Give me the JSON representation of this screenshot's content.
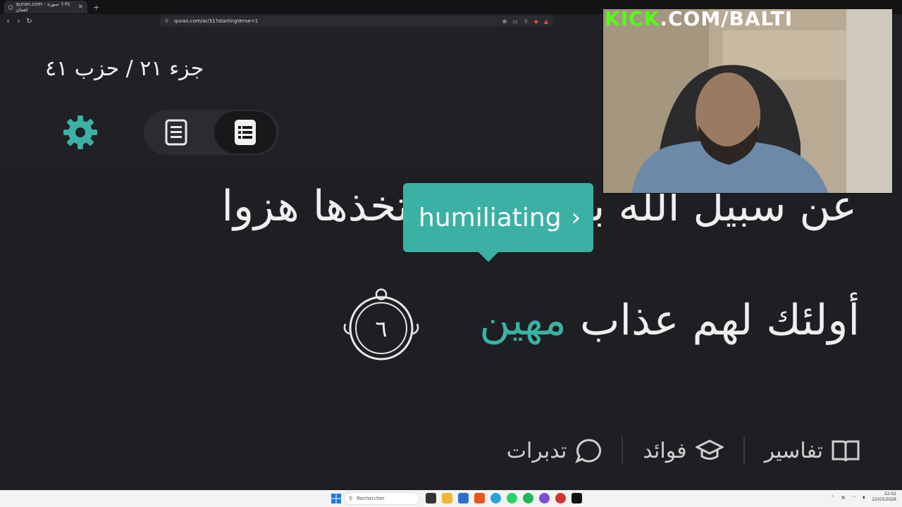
{
  "browser": {
    "tab_title": "quran.com - ٣٤-٦ سورة لقمان",
    "tab_close": "×",
    "new_tab": "+",
    "url": "quran.com/ar/31?startingVerse=1",
    "nav_back": "‹",
    "nav_forward": "›",
    "nav_reload": "↻"
  },
  "header": {
    "juz_hizb": "جزء ٢١ / حزب ٤١"
  },
  "verse": {
    "line1": "عن سبيل الله بغير علم ويتخذها هزوا",
    "line2_main": "أولئك لهم عذاب",
    "line2_highlight": "مهين",
    "ayah_number": "٦"
  },
  "tooltip": {
    "translation": "humiliating",
    "chevron": "›"
  },
  "bottom_nav": {
    "items": [
      {
        "label": "تفاسير",
        "icon": "book-icon"
      },
      {
        "label": "فوائد",
        "icon": "graduation-cap-icon"
      },
      {
        "label": "تدبرات",
        "icon": "chat-bubble-icon"
      }
    ]
  },
  "webcam": {
    "label_kick": "KICK",
    "label_rest": ".COM/BALTI"
  },
  "taskbar": {
    "search_placeholder": "Rechercher",
    "time": "22:02",
    "date": "22/03/2026"
  },
  "colors": {
    "accent": "#3bb1a5",
    "background": "#1d1f22",
    "kick_green": "#53fc18"
  }
}
